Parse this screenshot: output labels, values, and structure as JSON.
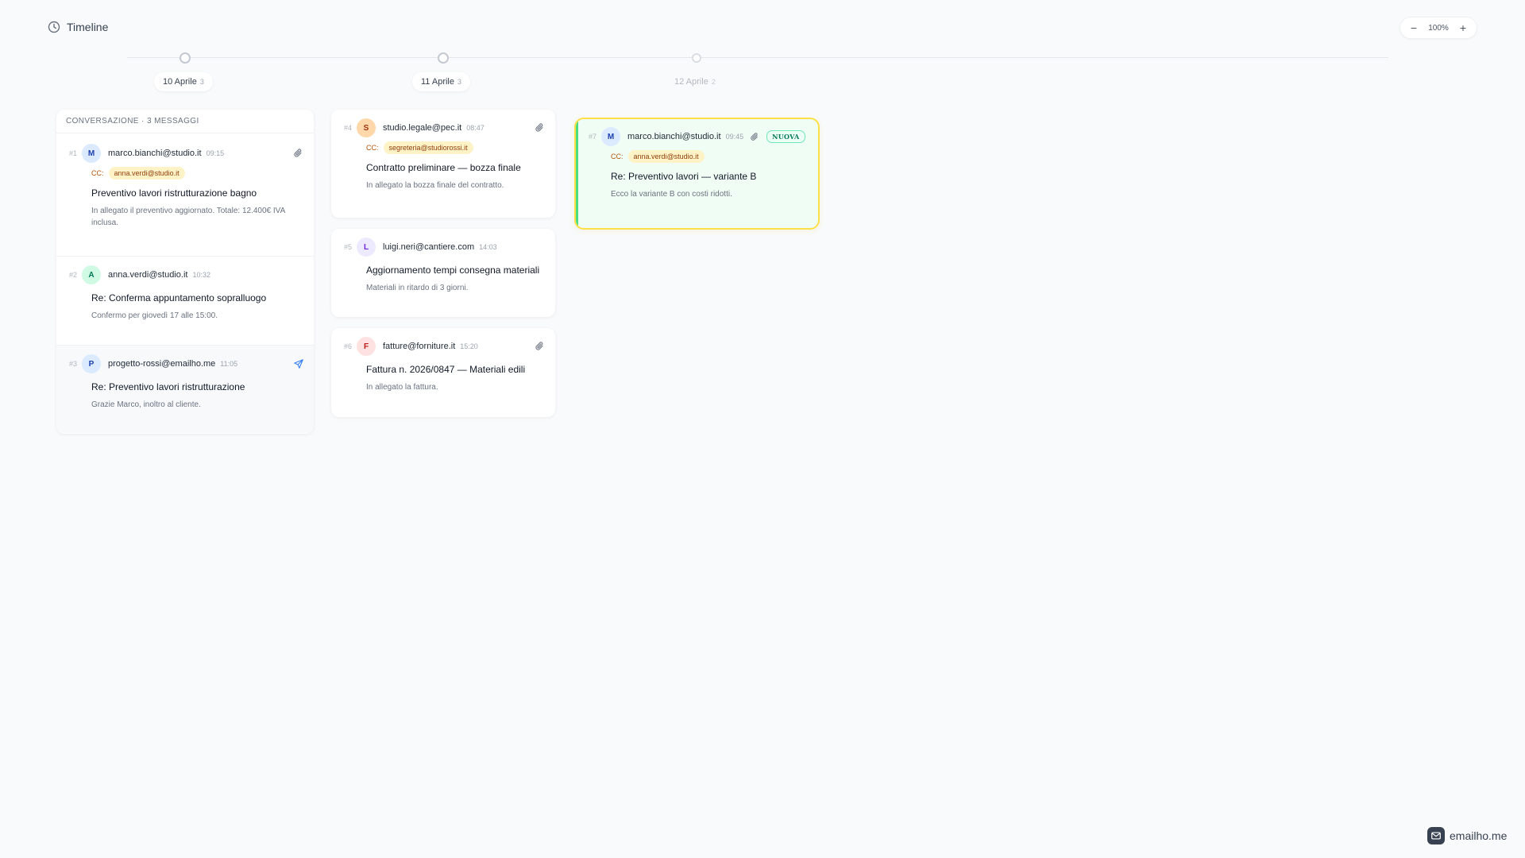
{
  "header": {
    "title": "Timeline",
    "icon": "clock-icon"
  },
  "zoom": {
    "minus": "−",
    "value": "100%",
    "plus": "+"
  },
  "dates": [
    {
      "label": "10 Aprile",
      "count": "3"
    },
    {
      "label": "11 Aprile",
      "count": "3"
    },
    {
      "label": "12 Aprile",
      "count": "2"
    }
  ],
  "conversation": {
    "heading": "CONVERSAZIONE · 3 MESSAGGI",
    "messages": [
      {
        "num": "#1",
        "initial": "M",
        "sender": "marco.bianchi@studio.it",
        "time": "09:15",
        "cc_label": "CC:",
        "cc": "anna.verdi@studio.it",
        "subject": "Preventivo lavori ristrutturazione bagno",
        "body": "In allegato il preventivo aggiornato. Totale: 12.400€ IVA inclusa.",
        "icon": "paperclip-icon"
      },
      {
        "num": "#2",
        "initial": "A",
        "sender": "anna.verdi@studio.it",
        "time": "10:32",
        "subject": "Re: Conferma appuntamento sopralluogo",
        "body": "Confermo per giovedì 17 alle 15:00."
      },
      {
        "num": "#3",
        "initial": "P",
        "sender": "progetto-rossi@emailho.me",
        "time": "11:05",
        "subject": "Re: Preventivo lavori ristrutturazione",
        "body": "Grazie Marco, inoltro al cliente.",
        "icon": "send-icon"
      }
    ]
  },
  "day2": [
    {
      "num": "#4",
      "initial": "S",
      "sender": "studio.legale@pec.it",
      "time": "08:47",
      "cc_label": "CC:",
      "cc": "segreteria@studiorossi.it",
      "subject": "Contratto preliminare — bozza finale",
      "body": "In allegato la bozza finale del contratto.",
      "icon": "paperclip-icon"
    },
    {
      "num": "#5",
      "initial": "L",
      "sender": "luigi.neri@cantiere.com",
      "time": "14:03",
      "subject": "Aggiornamento tempi consegna materiali",
      "body": "Materiali in ritardo di 3 giorni."
    },
    {
      "num": "#6",
      "initial": "F",
      "sender": "fatture@forniture.it",
      "time": "15:20",
      "subject": "Fattura n. 2026/0847 — Materiali edili",
      "body": "In allegato la fattura.",
      "icon": "paperclip-icon"
    }
  ],
  "day3": [
    {
      "num": "#7",
      "initial": "M",
      "sender": "marco.bianchi@studio.it",
      "time": "09:45",
      "badge": "NUOVA",
      "cc_label": "CC:",
      "cc": "anna.verdi@studio.it",
      "subject": "Re: Preventivo lavori — variante B",
      "body": "Ecco la variante B con costi ridotti.",
      "icon": "paperclip-icon"
    }
  ],
  "brand": {
    "name": "emailho.me",
    "icon": "mail-icon"
  },
  "colors": {
    "avatar_m": "#dbeafe",
    "avatar_a": "#d1fae5",
    "avatar_p": "#dbeafe",
    "avatar_s": "#fed7aa",
    "avatar_l": "#ede9fe",
    "avatar_f": "#fee2e2",
    "highlight_border": "#fde047",
    "highlight_bg": "#f0fdf4"
  }
}
